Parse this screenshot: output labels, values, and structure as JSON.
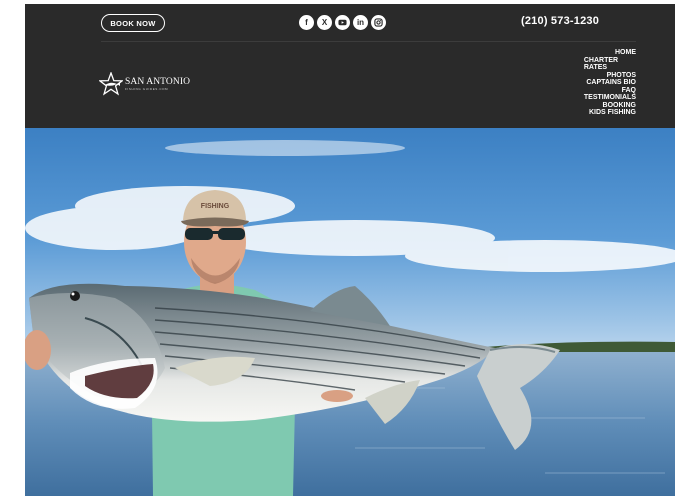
{
  "header": {
    "book_button_label": "BOOK NOW",
    "phone": "(210) 573-1230",
    "socials": [
      {
        "name": "facebook-icon",
        "glyph": "f"
      },
      {
        "name": "x-twitter-icon",
        "glyph": "X"
      },
      {
        "name": "youtube-icon",
        "glyph": ""
      },
      {
        "name": "linkedin-icon",
        "glyph": "in"
      },
      {
        "name": "instagram-icon",
        "glyph": ""
      }
    ]
  },
  "logo": {
    "main": "SAN ANTONIO",
    "sub": "FISHING GUIDES.COM"
  },
  "nav": {
    "home": "HOME",
    "charter": "CHARTER",
    "rates": "RATES",
    "photos": "PHOTOS",
    "captains_bio": "CAPTAINS BIO",
    "faq": "FAQ",
    "testimonials": "TESTIMONIALS",
    "booking": "BOOKING",
    "kids_fishing": "KIDS FISHING"
  },
  "hero": {
    "hat_text": "FISHING",
    "description": "Fishing guide holding a large striped bass on the lake",
    "colors": {
      "sky": "#5b9bd6",
      "water": "#6f98bf",
      "shirt": "#7fc9b0"
    }
  },
  "theme": {
    "header_bg": "#2a2a2a",
    "header_text": "#ffffff"
  }
}
